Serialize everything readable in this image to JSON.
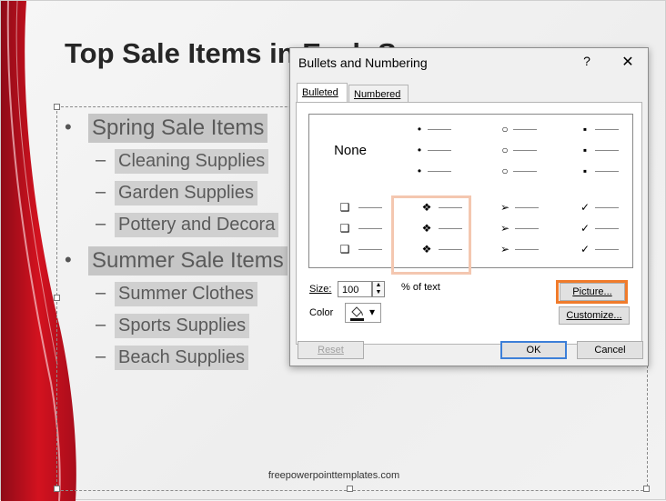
{
  "slide": {
    "title": "Top Sale Items in Each S",
    "level1": [
      {
        "label": "Spring Sale Items",
        "children": [
          "Cleaning Supplies",
          "Garden Supplies",
          "Pottery and Decora"
        ]
      },
      {
        "label": "Summer Sale Items",
        "children": [
          "Summer Clothes",
          "Sports Supplies",
          "Beach Supplies"
        ]
      }
    ],
    "bullet_l1": "•",
    "bullet_l2": "–",
    "footer": "freepowerpointtemplates.com"
  },
  "dialog": {
    "title": "Bullets and Numbering",
    "help": "?",
    "close": "✕",
    "tabs": [
      {
        "label": "Bulleted",
        "active": true
      },
      {
        "label": "Numbered",
        "active": false
      }
    ],
    "bullet_styles": {
      "none_label": "None",
      "filled_round": "•",
      "hollow_round": "○",
      "filled_square": "▪",
      "hollow_square": "❑",
      "star_diamond": "❖",
      "arrow": "➢",
      "check": "✓"
    },
    "selected_style": "star_diamond",
    "size_label": "Size:",
    "size_value": "100",
    "size_suffix": "% of text",
    "color_label": "Color",
    "picture_button": "Picture...",
    "customize_button": "Customize...",
    "reset_button": "Reset",
    "ok_button": "OK",
    "cancel_button": "Cancel",
    "spin_up": "▲",
    "spin_down": "▼",
    "color_icon": "paint-bucket-icon",
    "dropdown_icon": "▾"
  },
  "colors": {
    "accent_red": "#c8102e",
    "highlight_orange": "#f07b2b",
    "selection_peach": "#f4c7b0",
    "ok_border": "#3c7fd8"
  }
}
